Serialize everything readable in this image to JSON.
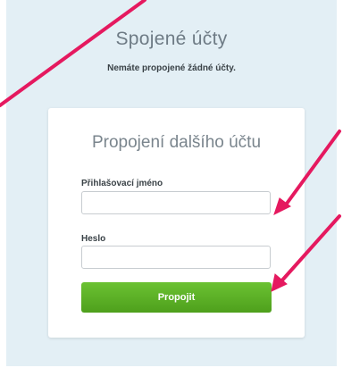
{
  "page": {
    "title": "Spojené účty",
    "subtitle": "Nemáte propojené žádné účty."
  },
  "card": {
    "title": "Propojení dalšího účtu",
    "username_label": "Přihlašovací jméno",
    "username_value": "",
    "password_label": "Heslo",
    "password_value": "",
    "submit_label": "Propojit"
  },
  "colors": {
    "background": "#e3eff5",
    "button_green": "#5cb125",
    "annotation_arrow": "#e5195f"
  }
}
